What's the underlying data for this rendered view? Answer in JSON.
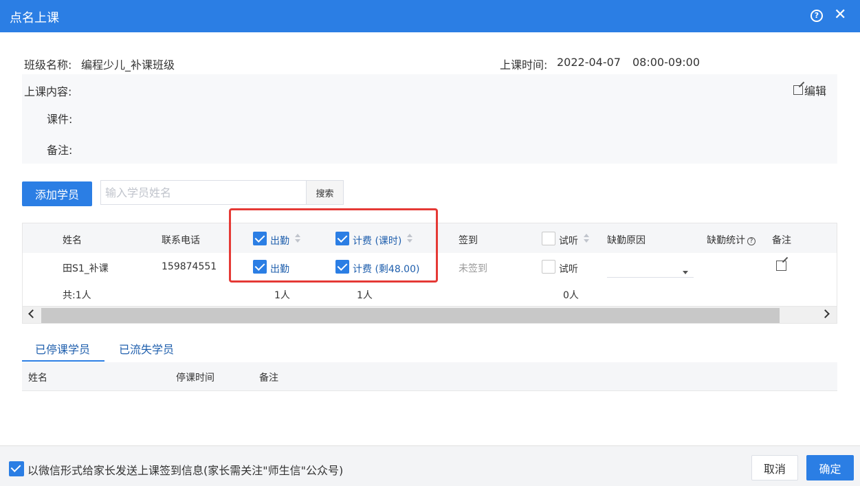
{
  "dialog": {
    "title": "点名上课"
  },
  "class_info": {
    "name_label": "班级名称:",
    "name_value": "编程少儿_补课班级",
    "time_label": "上课时间:",
    "date_value": "2022-04-07",
    "time_value": "08:00-09:00",
    "content_label": "上课内容:",
    "edit_label": "编辑",
    "courseware_label": "课件:",
    "note_label": "备注:"
  },
  "toolbar": {
    "add_student_label": "添加学员",
    "search_placeholder": "输入学员姓名",
    "search_label": "搜索"
  },
  "table": {
    "headers": {
      "name": "姓名",
      "phone": "联系电话",
      "attend": "出勤",
      "fee": "计费 (课时)",
      "signin": "签到",
      "trial": "试听",
      "absence_reason": "缺勤原因",
      "absence_stats": "缺勤统计",
      "remark": "备注"
    },
    "row": {
      "name": "田S1_补课",
      "phone": "159874551",
      "attend": "出勤",
      "attend_checked": true,
      "fee": "计费 (剩48.00)",
      "fee_checked": true,
      "signin": "未签到",
      "trial": "试听",
      "trial_checked": false
    },
    "summary": {
      "total": "共:1人",
      "attend_count": "1人",
      "fee_count": "1人",
      "trial_count": "0人"
    }
  },
  "tabs": [
    {
      "label": "已停课学员",
      "active": true
    },
    {
      "label": "已流失学员",
      "active": false
    }
  ],
  "stopped_table": {
    "headers": {
      "name": "姓名",
      "stop_time": "停课时间",
      "remark": "备注"
    }
  },
  "footer": {
    "wechat_notice": "以微信形式给家长发送上课签到信息(家长需关注\"师生信\"公众号)",
    "wechat_checked": true,
    "cancel_label": "取消",
    "confirm_label": "确定"
  },
  "colors": {
    "primary": "#2b7ee4",
    "highlight": "#e53935"
  },
  "icons": [
    "help-icon",
    "close-icon",
    "edit-icon",
    "sort-icon",
    "question-icon",
    "chevron-down-icon",
    "arrow-left-icon",
    "arrow-right-icon",
    "check-icon"
  ]
}
